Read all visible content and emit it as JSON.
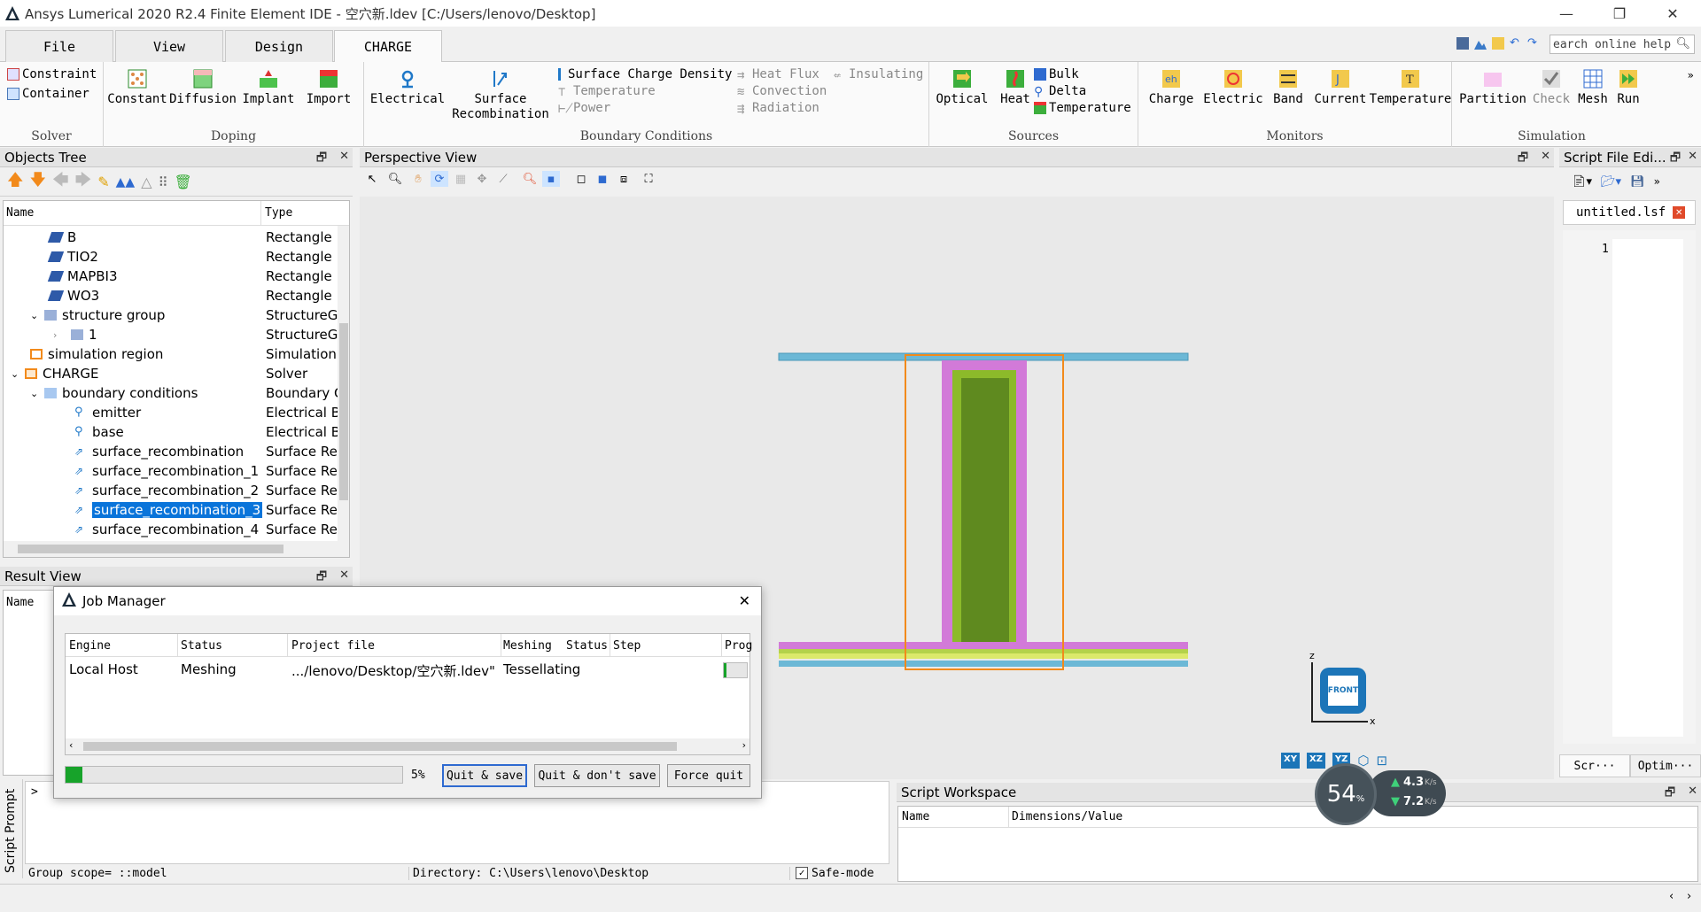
{
  "window": {
    "title": "Ansys Lumerical 2020 R2.4 Finite Element IDE - 空穴新.ldev [C:/Users/lenovo/Desktop]",
    "min": "—",
    "max": "❐",
    "close": "✕"
  },
  "tabs": [
    {
      "label": "File"
    },
    {
      "label": "View"
    },
    {
      "label": "Design"
    },
    {
      "label": "CHARGE"
    }
  ],
  "help": {
    "placeholder": "earch online help"
  },
  "ribbon": {
    "solver": {
      "label": "Solver",
      "items": [
        "Constraint",
        "Container"
      ]
    },
    "doping": {
      "label": "Doping",
      "items": [
        "Constant",
        "Diffusion",
        "Implant",
        "Import"
      ]
    },
    "bc": {
      "label": "Boundary Conditions",
      "electrical": "Electrical",
      "surface": "Surface",
      "recomb": "Recombination",
      "small": [
        "Surface Charge Density",
        "Temperature",
        "Power",
        "Heat Flux",
        "Convection",
        "Radiation",
        "Insulating"
      ]
    },
    "sources": {
      "label": "Sources",
      "items": [
        "Optical",
        "Heat"
      ],
      "small": [
        "Bulk",
        "Delta",
        "Temperature"
      ]
    },
    "monitors": {
      "label": "Monitors",
      "items": [
        "Charge",
        "Electric",
        "Band",
        "Current",
        "Temperature"
      ]
    },
    "simulation": {
      "label": "Simulation",
      "items": [
        "Partition",
        "Check",
        "Mesh",
        "Run"
      ]
    }
  },
  "objects_tree": {
    "title": "Objects Tree",
    "col_name": "Name",
    "col_type": "Type",
    "rows": [
      {
        "name": "B",
        "type": "Rectangle"
      },
      {
        "name": "TIO2",
        "type": "Rectangle"
      },
      {
        "name": "MAPBI3",
        "type": "Rectangle"
      },
      {
        "name": "WO3",
        "type": "Rectangle"
      },
      {
        "name": "structure group",
        "type": "StructureG"
      },
      {
        "name": "1",
        "type": "StructureG"
      },
      {
        "name": "simulation region",
        "type": "Simulation"
      },
      {
        "name": "CHARGE",
        "type": "Solver"
      },
      {
        "name": "boundary conditions",
        "type": "Boundary C"
      },
      {
        "name": "emitter",
        "type": "Electrical B"
      },
      {
        "name": "base",
        "type": "Electrical B"
      },
      {
        "name": "surface_recombination",
        "type": "Surface Re"
      },
      {
        "name": "surface_recombination_1",
        "type": "Surface Re"
      },
      {
        "name": "surface_recombination_2",
        "type": "Surface Re"
      },
      {
        "name": "surface_recombination_3",
        "type": "Surface Re"
      },
      {
        "name": "surface_recombination_4",
        "type": "Surface Re"
      }
    ]
  },
  "perspective": {
    "title": "Perspective View",
    "axis_z": "z",
    "axis_x": "x",
    "cube": "FRONT",
    "views": [
      "XY",
      "XZ",
      "YZ"
    ]
  },
  "script_editor": {
    "title": "Script File Edi...",
    "file": "untitled.lsf",
    "line": "1",
    "tab1": "Scr···",
    "tab2": "Optim···"
  },
  "result_view": {
    "title": "Result View",
    "col_name": "Name"
  },
  "job_manager": {
    "title": "Job Manager",
    "cols": [
      "Engine",
      "Status",
      "Project file",
      "Meshing",
      "Status",
      "Step",
      "Prog"
    ],
    "row": {
      "engine": "Local Host",
      "status": "Meshing",
      "project": ".../lenovo/Desktop/空穴新.ldev\"",
      "meshing": "Tessellating"
    },
    "progress": 0.05,
    "percent": "5%",
    "buttons": [
      "Quit & save",
      "Quit & don't save",
      "Force quit"
    ]
  },
  "script_prompt": {
    "label": "Script Prompt",
    "prompt": ">",
    "scope": "Group scope= ::model",
    "dir": "Directory: C:\\Users\\lenovo\\Desktop",
    "safe": "Safe-mode"
  },
  "workspace": {
    "title": "Script Workspace",
    "col_name": "Name",
    "col_dim": "Dimensions/Value"
  },
  "net": {
    "pct": "54",
    "pct_unit": "%",
    "up": "4.3",
    "down": "7.2",
    "unit": "K/s"
  },
  "colors": {
    "accent": "#0a74da",
    "panel": "#e4e4e4"
  }
}
